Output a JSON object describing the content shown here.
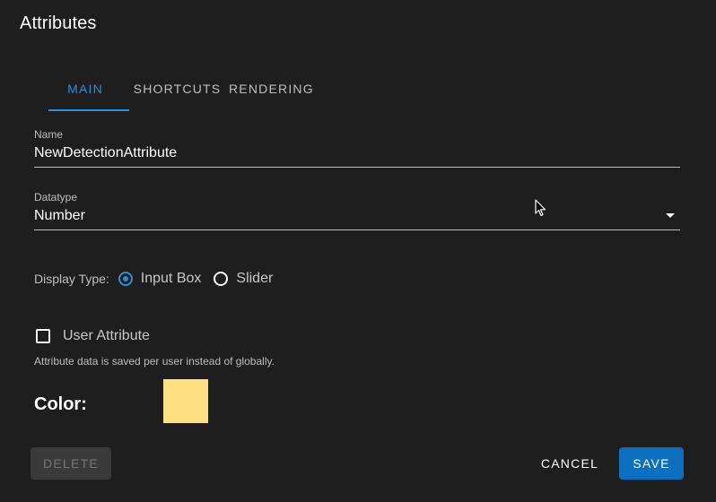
{
  "dialog": {
    "title": "Attributes"
  },
  "tabs": [
    {
      "label": "MAIN",
      "active": true
    },
    {
      "label": "SHORTCUTS",
      "active": false
    },
    {
      "label": "RENDERING",
      "active": false
    }
  ],
  "name_field": {
    "label": "Name",
    "value": "NewDetectionAttribute"
  },
  "datatype_field": {
    "label": "Datatype",
    "value": "Number",
    "icon": "chevron-down-icon"
  },
  "display_type": {
    "label": "Display Type:",
    "options": [
      {
        "label": "Input Box",
        "selected": true
      },
      {
        "label": "Slider",
        "selected": false
      }
    ]
  },
  "user_attribute": {
    "label": "User Attribute",
    "checked": false,
    "hint": "Attribute data is saved per user instead of globally."
  },
  "color": {
    "label": "Color:",
    "value": "#ffe082"
  },
  "actions": {
    "delete_label": "DELETE",
    "cancel_label": "CANCEL",
    "save_label": "SAVE"
  },
  "colors": {
    "background": "#1e1e1e",
    "accent": "#2f8fd8",
    "save_button": "#0d6fbf"
  }
}
